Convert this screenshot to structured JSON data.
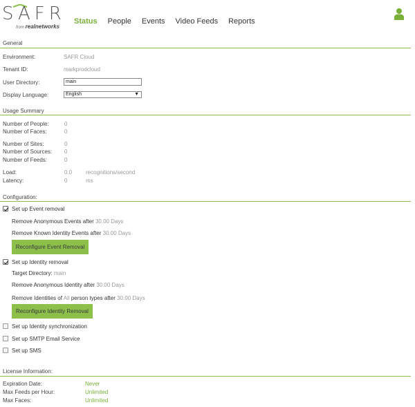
{
  "header": {
    "logo_text": "SAFR",
    "logo_from": "from",
    "logo_brand": "realnetworks",
    "nav": [
      "Status",
      "People",
      "Events",
      "Video Feeds",
      "Reports"
    ]
  },
  "general": {
    "title": "General",
    "environment_label": "Environment:",
    "environment_value": "SAFR Cloud",
    "tenant_label": "Tenant ID:",
    "tenant_value": "markprodcloud",
    "user_directory_label": "User Directory:",
    "user_directory_value": "main",
    "display_language_label": "Display Language:",
    "display_language_value": "English"
  },
  "usage": {
    "title": "Usage Summary",
    "people_label": "Number of People:",
    "people_value": "0",
    "faces_label": "Number of Faces:",
    "faces_value": "0",
    "sites_label": "Number of Sites:",
    "sites_value": "0",
    "sources_label": "Number of Sources:",
    "sources_value": "0",
    "feeds_label": "Number of Feeds:",
    "feeds_value": "0",
    "load_label": "Load:",
    "load_value": "0.0",
    "load_unit": "recognitions/second",
    "latency_label": "Latency:",
    "latency_value": "0",
    "latency_unit": "ms"
  },
  "configuration": {
    "title": "Configuration:",
    "event_removal": {
      "label": "Set up Event removal",
      "checked": true,
      "anon_prefix": "Remove Anonymous Events after",
      "anon_value": "30.00 Days",
      "known_prefix": "Remove Known Identity Events after",
      "known_value": "30.00 Days",
      "button": "Reconfigure Event Removal"
    },
    "identity_removal": {
      "label": "Set up Identity removal",
      "checked": true,
      "target_prefix": "Target Directory:",
      "target_value": "main",
      "anon_prefix": "Remove Anonymous Identity after",
      "anon_value": "30.00 Days",
      "all_prefix_1": "Remove Identities of",
      "all_highlight": "All",
      "all_prefix_2": "person types after",
      "all_value": "30.00 Days",
      "button": "Reconfigure Identity Removal"
    },
    "identity_sync": {
      "label": "Set up Identity synchronization",
      "checked": false
    },
    "smtp": {
      "label": "Set up SMTP Email Service",
      "checked": false
    },
    "sms": {
      "label": "Set up SMS",
      "checked": false
    }
  },
  "license": {
    "title": "License Information:",
    "expiration_label": "Expiration Date:",
    "expiration_value": "Never",
    "feeds_label": "Max Feeds per Hour:",
    "feeds_value": "Unlimited",
    "faces_label": "Max Faces:",
    "faces_value": "Unlimited"
  },
  "colors": {
    "accent": "#8cc04b",
    "accent_text": "#7ab03a",
    "muted": "#999999"
  },
  "icons": [
    "user-icon",
    "checkmark-icon",
    "chevron-down-icon"
  ]
}
